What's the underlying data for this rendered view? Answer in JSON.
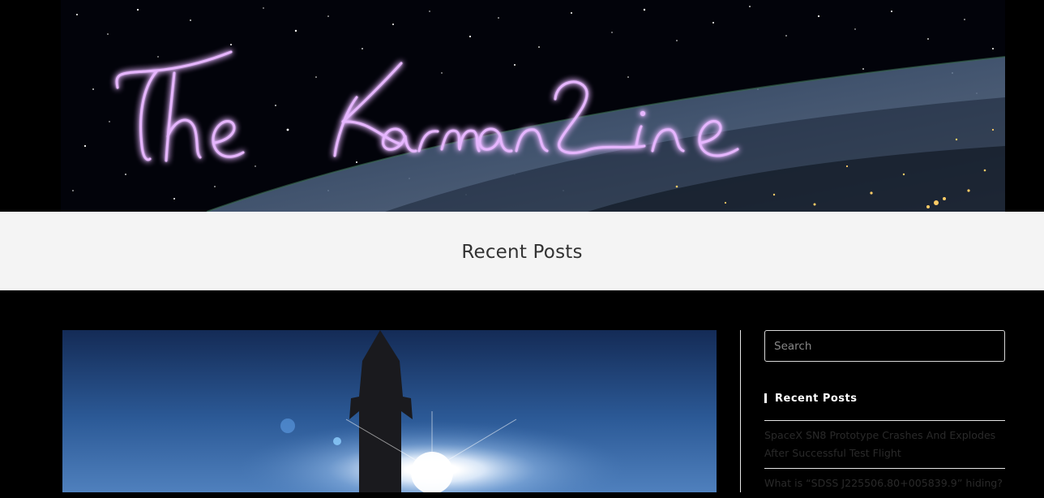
{
  "site": {
    "logo_text": "The Karman Line",
    "logo_alt": "The Karman Line"
  },
  "page": {
    "title": "Recent Posts"
  },
  "featured_post": {
    "image_alt": "SpaceX SN8 Prototype"
  },
  "sidebar": {
    "search": {
      "placeholder": "Search",
      "value": ""
    },
    "recent_posts_widget": {
      "title": "Recent Posts",
      "items": [
        {
          "label": "SpaceX SN8 Prototype Crashes And Explodes After Successful Test Flight"
        },
        {
          "label": "What is “SDSS J225506.80+005839.9” hiding?"
        }
      ]
    }
  },
  "colors": {
    "page_background": "#000000",
    "title_band": "#f4f4f4",
    "title_text": "#333333",
    "widget_title": "#ffffff",
    "post_link": "#2a2a2a",
    "neon_purple": "#c070ff"
  }
}
